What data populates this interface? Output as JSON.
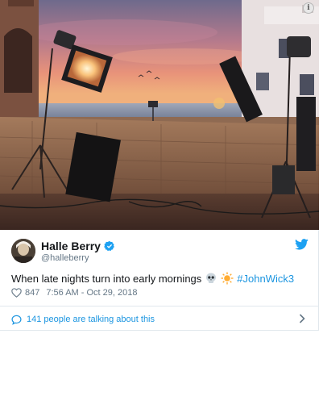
{
  "photo": {
    "description_icon": "info-icon",
    "icon_glyph": "i"
  },
  "author": {
    "display_name": "Halle Berry",
    "handle": "@halleberry",
    "verified": true
  },
  "tweet": {
    "text": "When late nights turn into early mornings",
    "emojis": [
      "skull-emoji",
      "sun-emoji"
    ],
    "hashtag": "#JohnWick3",
    "likes": "847",
    "timestamp": "7:56 AM - Oct 29, 2018"
  },
  "conversation": {
    "label": "141 people are talking about this"
  },
  "colors": {
    "link_blue": "#1b95e0",
    "text_primary": "#14171a",
    "text_secondary": "#657786",
    "border": "#e1e8ed"
  }
}
